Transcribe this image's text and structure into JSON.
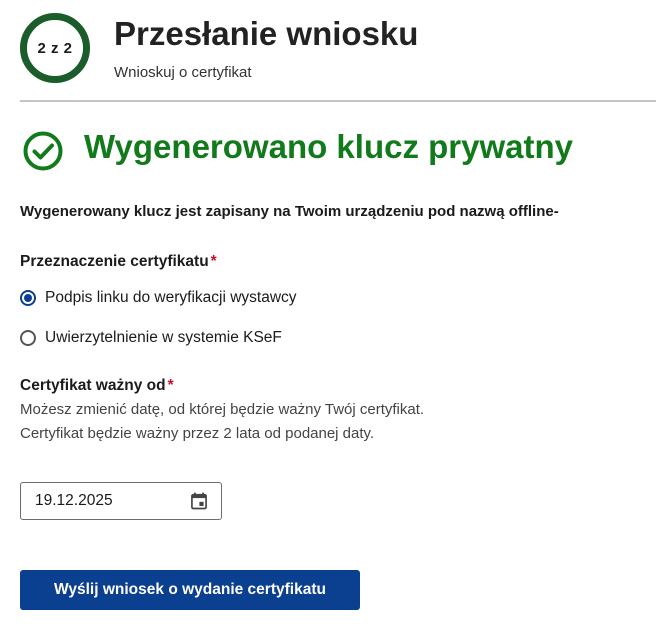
{
  "header": {
    "step_indicator": "2 z 2",
    "title": "Przesłanie wniosku",
    "subtitle": "Wnioskuj o certyfikat"
  },
  "success": {
    "icon": "check-circle-icon",
    "heading": "Wygenerowano klucz prywatny",
    "info": "Wygenerowany klucz jest zapisany na Twoim urządzeniu pod nazwą offline-"
  },
  "purpose": {
    "label": "Przeznaczenie certyfikatu",
    "required_mark": "*",
    "options": [
      {
        "label": "Podpis linku do weryfikacji wystawcy",
        "checked": true
      },
      {
        "label": "Uwierzytelnienie w systemie KSeF",
        "checked": false
      }
    ]
  },
  "valid_from": {
    "label": "Certyfikat ważny od",
    "required_mark": "*",
    "hint": "Możesz zmienić datę, od której będzie ważny Twój certyfikat. Certyfikat będzie ważny przez 2 lata od podanej daty.",
    "value": "19.12.2025",
    "icon": "calendar-icon"
  },
  "submit": {
    "label": "Wyślij wniosek o wydanie certyfikatu"
  },
  "colors": {
    "success_green": "#117a1b",
    "step_ring": "#1a5c2a",
    "primary_blue": "#0b3f8f",
    "required_red": "#c8102e"
  }
}
